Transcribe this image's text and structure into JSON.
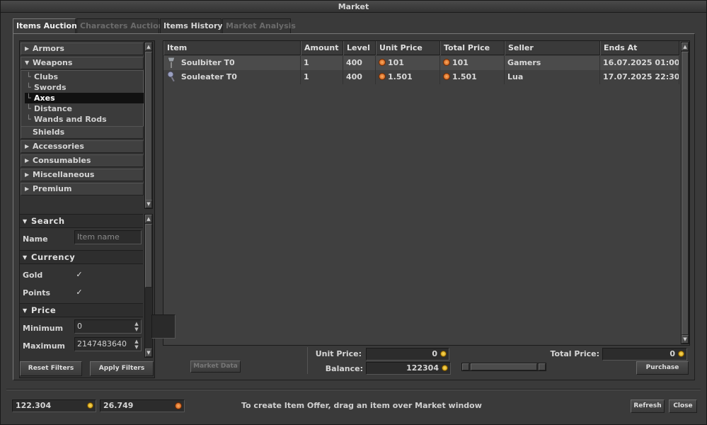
{
  "window": {
    "title": "Market"
  },
  "tabs": [
    {
      "label": "Items Auction",
      "state": "active"
    },
    {
      "label": "Characters Auction",
      "state": "disabled"
    },
    {
      "label": "Items History",
      "state": "normal"
    },
    {
      "label": "Market Analysis",
      "state": "disabled"
    }
  ],
  "categories": {
    "armors": "Armors",
    "weapons": "Weapons",
    "weapon_subs": [
      "Clubs",
      "Swords",
      "Axes",
      "Distance",
      "Wands and Rods"
    ],
    "selected_sub": "Axes",
    "shields": "Shields",
    "accessories": "Accessories",
    "consumables": "Consumables",
    "miscellaneous": "Miscellaneous",
    "premium": "Premium"
  },
  "filters": {
    "search_title": "Search",
    "name_label": "Name",
    "name_placeholder": "Item name",
    "currency_title": "Currency",
    "gold_label": "Gold",
    "points_label": "Points",
    "gold_checked": true,
    "points_checked": true,
    "price_title": "Price",
    "min_label": "Minimum",
    "min_value": "0",
    "max_label": "Maximum",
    "max_value": "2147483640",
    "reset_label": "Reset Filters",
    "apply_label": "Apply Filters"
  },
  "table": {
    "columns": [
      "Item",
      "Amount",
      "Level",
      "Unit Price",
      "Total Price",
      "Seller",
      "Ends At"
    ],
    "rows": [
      {
        "item": "Soulbiter T0",
        "amount": "1",
        "level": "400",
        "unit_price": "101",
        "total_price": "101",
        "seller": "Gamers",
        "ends_at": "16.07.2025 01:00"
      },
      {
        "item": "Souleater T0",
        "amount": "1",
        "level": "400",
        "unit_price": "1.501",
        "total_price": "1.501",
        "seller": "Lua",
        "ends_at": "17.07.2025 22:30"
      }
    ]
  },
  "offer": {
    "market_data_label": "Market Data",
    "unit_price_label": "Unit Price:",
    "unit_price_value": "0",
    "balance_label": "Balance:",
    "balance_value": "122304",
    "total_price_label": "Total Price:",
    "total_price_value": "0",
    "purchase_label": "Purchase"
  },
  "footer": {
    "gold_balance": "122.304",
    "points_balance": "26.749",
    "hint": "To create Item Offer, drag an item over Market window",
    "refresh_label": "Refresh",
    "close_label": "Close"
  },
  "colors": {
    "background": "#3a3a3a",
    "selected_row": "#4b4b4b",
    "selected_sub": "#111111",
    "coin_orange": "#e06a20",
    "coin_gold": "#e0b020"
  }
}
